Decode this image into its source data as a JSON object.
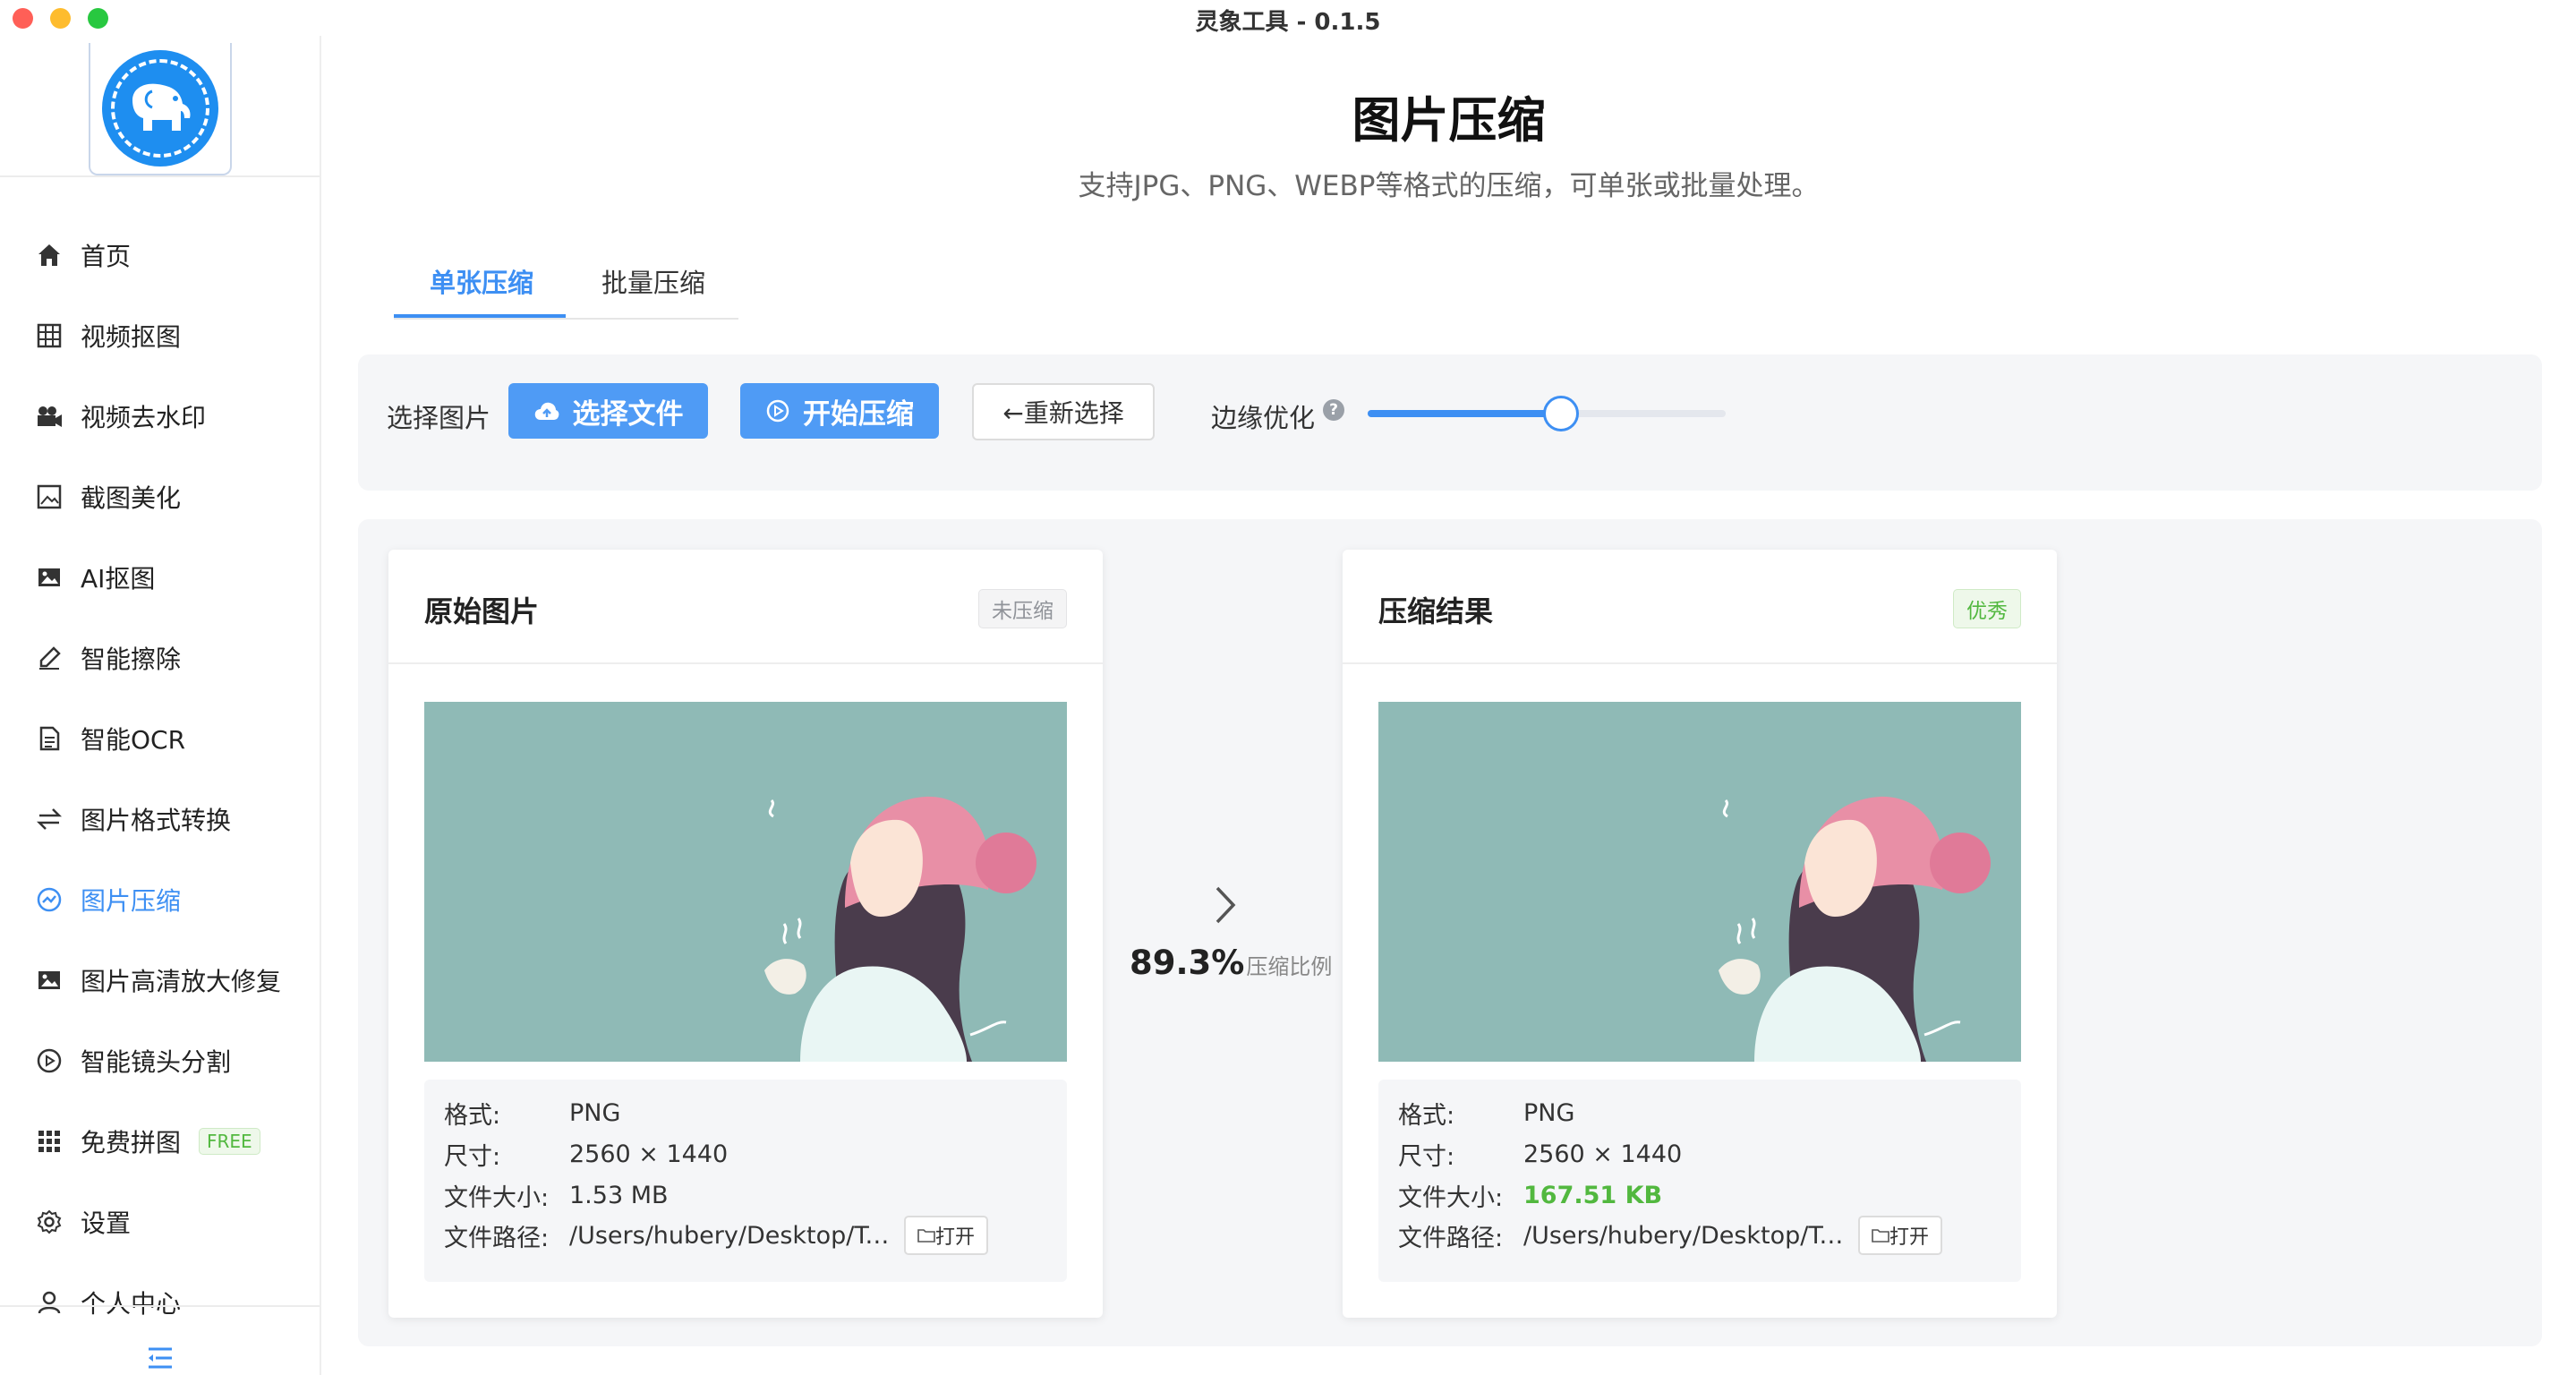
{
  "window": {
    "title": "灵象工具 - 0.1.5"
  },
  "sidebar": {
    "items": [
      {
        "label": "首页",
        "icon": "home-icon"
      },
      {
        "label": "视频抠图",
        "icon": "grid-icon"
      },
      {
        "label": "视频去水印",
        "icon": "camera-icon"
      },
      {
        "label": "截图美化",
        "icon": "picture-frame-icon"
      },
      {
        "label": "AI抠图",
        "icon": "image-icon"
      },
      {
        "label": "智能擦除",
        "icon": "eraser-icon"
      },
      {
        "label": "智能OCR",
        "icon": "document-icon"
      },
      {
        "label": "图片格式转换",
        "icon": "swap-icon"
      },
      {
        "label": "图片压缩",
        "icon": "compress-icon",
        "active": true
      },
      {
        "label": "图片高清放大修复",
        "icon": "image-icon"
      },
      {
        "label": "智能镜头分割",
        "icon": "play-circle-icon"
      },
      {
        "label": "免费拼图",
        "icon": "apps-grid-icon",
        "badge": "FREE"
      },
      {
        "label": "设置",
        "icon": "gear-icon"
      },
      {
        "label": "个人中心",
        "icon": "user-icon"
      }
    ]
  },
  "main": {
    "title": "图片压缩",
    "subtitle": "支持JPG、PNG、WEBP等格式的压缩，可单张或批量处理。",
    "tabs": [
      {
        "label": "单张压缩",
        "active": true
      },
      {
        "label": "批量压缩"
      }
    ],
    "toolbar": {
      "select_label": "选择图片",
      "select_file_button": "选择文件",
      "start_button": "开始压缩",
      "reselect_button": "←重新选择",
      "edge_label": "边缘优化",
      "help_glyph": "?",
      "edge_value": 0.54
    },
    "original": {
      "title": "原始图片",
      "tag": "未压缩",
      "format_label": "格式:",
      "format": "PNG",
      "size_label": "尺寸:",
      "size": "2560 × 1440",
      "filesize_label": "文件大小:",
      "filesize": "1.53 MB",
      "path_label": "文件路径:",
      "path": "/Users/hubery/Desktop/TestI...",
      "open_button": "打开"
    },
    "ratio": {
      "value": "89.3%",
      "label": "压缩比例"
    },
    "result": {
      "title": "压缩结果",
      "tag": "优秀",
      "format_label": "格式:",
      "format": "PNG",
      "size_label": "尺寸:",
      "size": "2560 × 1440",
      "filesize_label": "文件大小:",
      "filesize": "167.51 KB",
      "path_label": "文件路径:",
      "path": "/Users/hubery/Desktop/TestI...",
      "open_button": "打开"
    }
  },
  "colors": {
    "accent": "#3d8ff3",
    "success": "#52b83f",
    "image_bg": "#8fbab6"
  }
}
